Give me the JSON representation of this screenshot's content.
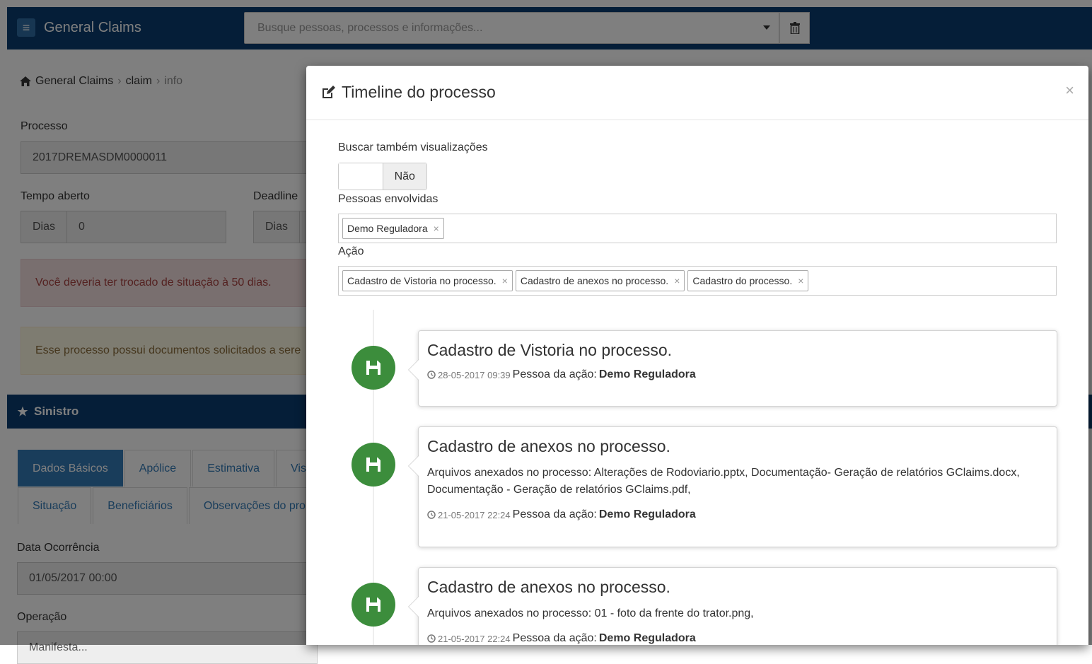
{
  "navbar": {
    "brand": "General Claims",
    "search_placeholder": "Busque pessoas, processos e informações..."
  },
  "breadcrumb": {
    "home": "General Claims",
    "claim": "claim",
    "info": "info"
  },
  "form": {
    "processo_label": "Processo",
    "processo_value": "2017DREMASDM0000011",
    "tempo_label": "Tempo aberto",
    "tempo_addon": "Dias",
    "tempo_value": "0",
    "deadline_label": "Deadline",
    "deadline_addon": "Dias",
    "alert_red": "Você deveria ter trocado de situação à 50 dias.",
    "alert_yellow": "Esse processo possui documentos solicitados a sere",
    "panel_title": "Sinistro",
    "tabs_row1": [
      "Dados Básicos",
      "Apólice",
      "Estimativa",
      "Vis"
    ],
    "tabs_row2": [
      "Situação",
      "Beneficiários",
      "Observações do pro"
    ],
    "data_ocorrencia_label": "Data Ocorrência",
    "data_ocorrencia_value": "01/05/2017 00:00",
    "operacao_label": "Operação",
    "operacao_value": "Manifesta..."
  },
  "modal": {
    "title": "Timeline do processo",
    "close": "×",
    "buscar_label": "Buscar também visualizações",
    "toggle_off": "Não",
    "pessoas_label": "Pessoas envolvidas",
    "pessoas_tags": [
      "Demo Reguladora"
    ],
    "acao_label": "Ação",
    "acao_tags": [
      "Cadastro de Vistoria no processo.",
      "Cadastro de anexos no processo.",
      "Cadastro do processo."
    ],
    "tag_remove": "×",
    "events": [
      {
        "title": "Cadastro de Vistoria no processo.",
        "body": "",
        "time": "28-05-2017 09:39",
        "person_label": "Pessoa da ação:",
        "person": "Demo Reguladora"
      },
      {
        "title": "Cadastro de anexos no processo.",
        "body": "Arquivos anexados no processo: Alterações de Rodoviario.pptx, Documentação- Geração de relatórios GClaims.docx, Documentação - Geração de relatórios GClaims.pdf,",
        "time": "21-05-2017 22:24",
        "person_label": "Pessoa da ação:",
        "person": "Demo Reguladora"
      },
      {
        "title": "Cadastro de anexos no processo.",
        "body": "Arquivos anexados no processo: 01 - foto da frente do trator.png,",
        "time": "21-05-2017 22:24",
        "person_label": "Pessoa da ação:",
        "person": "Demo Reguladora"
      }
    ]
  },
  "colors": {
    "navbar": "#0a3d70",
    "primary": "#337ab7",
    "success": "#3c8d3c"
  }
}
